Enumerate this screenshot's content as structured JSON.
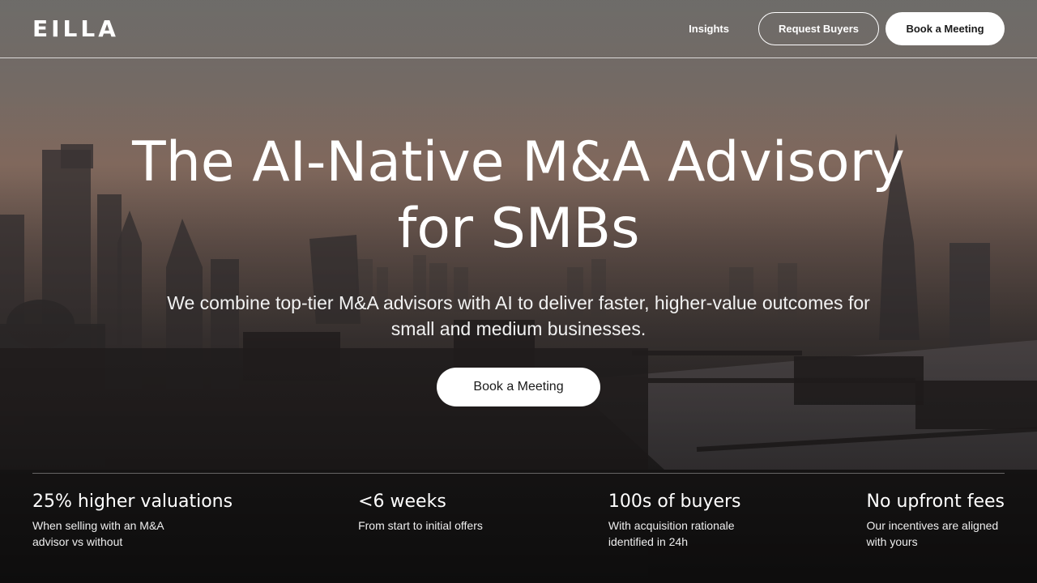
{
  "brand": {
    "logo_text": "EILLA"
  },
  "nav": {
    "insights": "Insights",
    "request_buyers": "Request Buyers",
    "book_meeting": "Book a Meeting"
  },
  "hero": {
    "title_line1": "The AI-Native M&A Advisory",
    "title_line2": "for SMBs",
    "subtitle_line1": "We combine top-tier M&A advisors with AI to deliver faster, higher-value outcomes for",
    "subtitle_line2": "small and medium businesses.",
    "cta": "Book a Meeting"
  },
  "stats": [
    {
      "title": "25% higher valuations",
      "line1": "When selling with an M&A",
      "line2": "advisor vs without"
    },
    {
      "title": "<6 weeks",
      "line1": "From start to initial offers",
      "line2": ""
    },
    {
      "title": "100s of buyers",
      "line1": "With acquisition rationale",
      "line2": "identified in 24h"
    },
    {
      "title": "No upfront fees",
      "line1": "Our incentives are aligned",
      "line2": "with yours"
    }
  ]
}
